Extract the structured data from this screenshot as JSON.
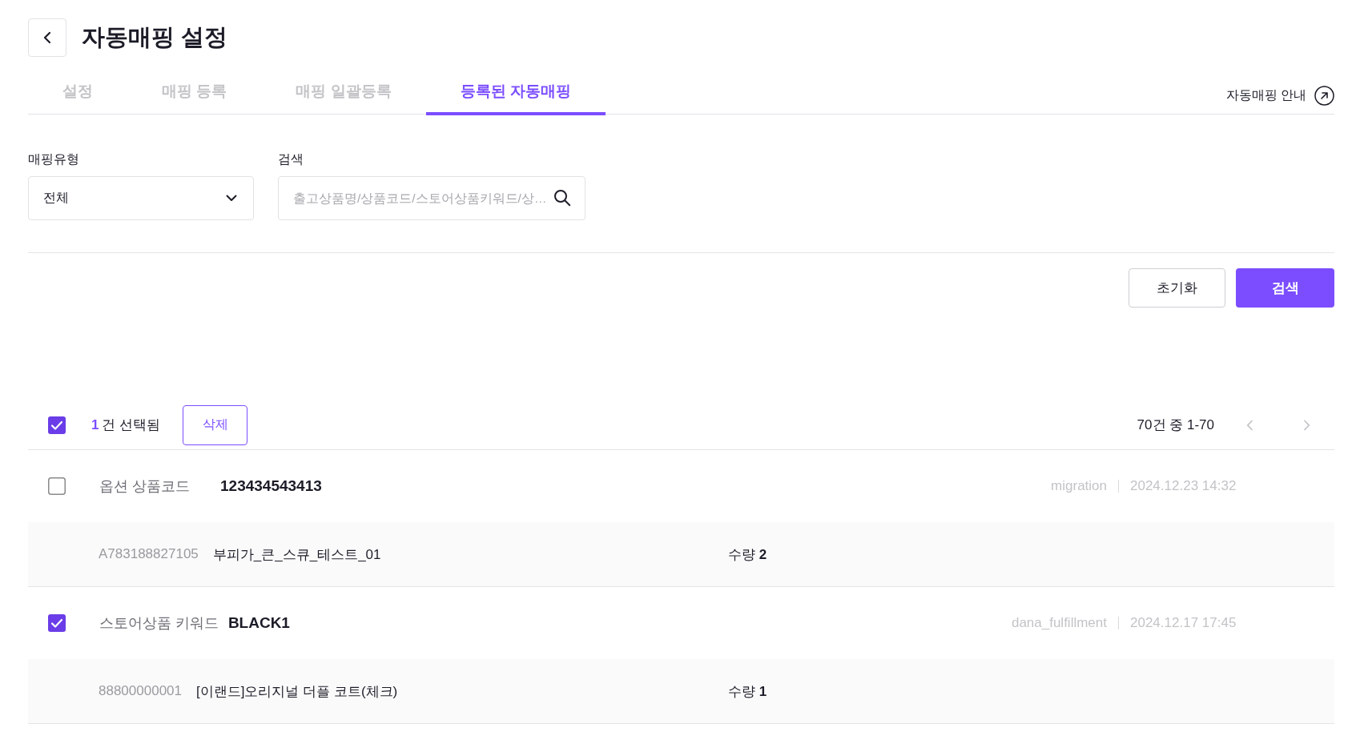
{
  "page": {
    "title": "자동매핑 설정"
  },
  "tabs": [
    {
      "label": "설정",
      "selected": false
    },
    {
      "label": "매핑 등록",
      "selected": false
    },
    {
      "label": "매핑 일괄등록",
      "selected": false
    },
    {
      "label": "등록된 자동매핑",
      "selected": true
    }
  ],
  "guide_link": {
    "label": "자동매핑 안내"
  },
  "filters": {
    "mapping_type": {
      "label": "매핑유형",
      "value": "전체"
    },
    "search": {
      "label": "검색",
      "placeholder": "출고상품명/상품코드/스토어상품키워드/상…"
    }
  },
  "buttons": [
    {
      "label": "초기화",
      "kind": "secondary"
    },
    {
      "label": "검색",
      "kind": "primary"
    }
  ],
  "selection": {
    "checked": true,
    "count": "1",
    "text": "건 선택됨",
    "delete_button": "삭제"
  },
  "pagination": {
    "range": "70건 중 1-70"
  },
  "mappings": [
    {
      "checked": false,
      "type": "옵션 상품코드",
      "key": "123434543413",
      "user": "migration",
      "date": "2024.12.23 14:32",
      "items": [
        {
          "code": "A783188827105",
          "name": "부피가_큰_스큐_테스트_01",
          "quantity": "수량 **2**"
        }
      ]
    },
    {
      "checked": true,
      "type": "스토어상품 키워드",
      "key": "BLACK1",
      "user": "dana_fulfillment",
      "date": "2024.12.17 17:45",
      "items": [
        {
          "code": "88800000001",
          "name": "[이랜드]오리지널 더플 코트(체크)",
          "quantity": "수량 **1**"
        }
      ]
    }
  ]
}
